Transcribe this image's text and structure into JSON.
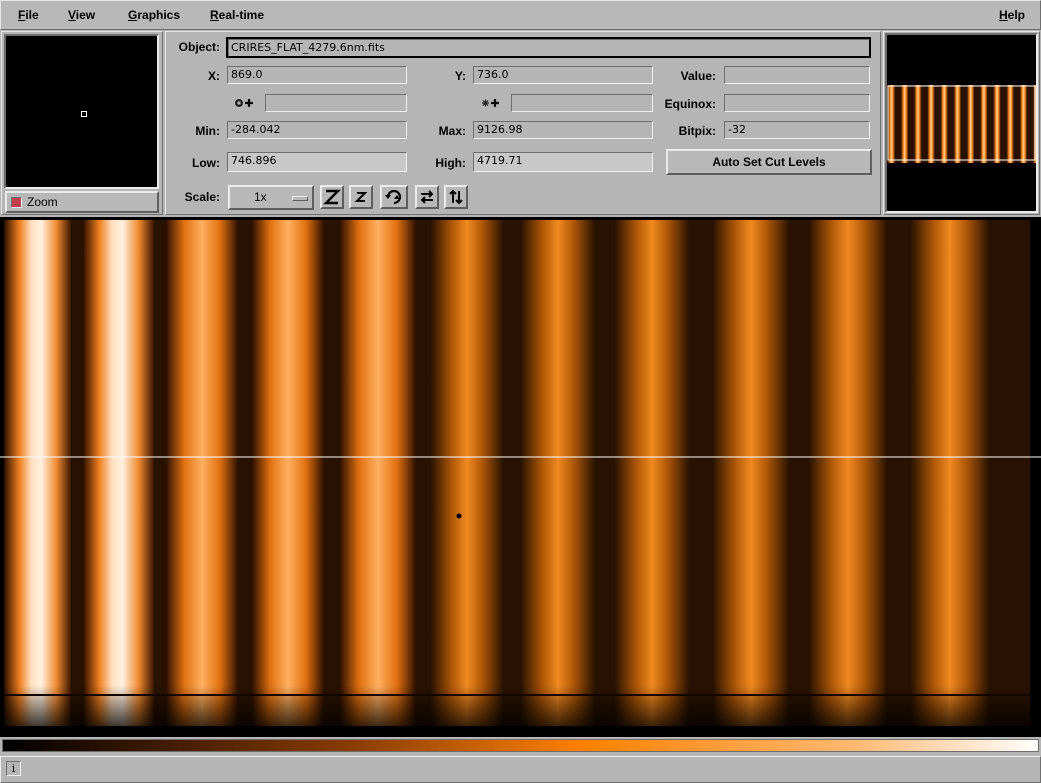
{
  "menubar": {
    "file": {
      "u": "F",
      "rest": "ile"
    },
    "view": {
      "u": "V",
      "rest": "iew"
    },
    "graphics": {
      "u": "G",
      "rest": "raphics"
    },
    "realtime": {
      "u": "R",
      "rest": "eal-time"
    },
    "help": {
      "u": "H",
      "rest": "elp"
    }
  },
  "zoom": {
    "label": "Zoom",
    "checked": true
  },
  "info": {
    "object_label": "Object:",
    "object_value": "CRIRES_FLAT_4279.6nm.fits",
    "x_label": "X:",
    "x_value": "869.0",
    "y_label": "Y:",
    "y_value": "736.0",
    "value_label": "Value:",
    "value_value": "",
    "ra_icon": "ra-crosshair-icon",
    "ra_value": "",
    "dec_icon": "dec-crosshair-icon",
    "dec_value": "",
    "equinox_label": "Equinox:",
    "equinox_value": "",
    "min_label": "Min:",
    "min_value": "-284.042",
    "max_label": "Max:",
    "max_value": "9126.98",
    "bitpix_label": "Bitpix:",
    "bitpix_value": "-32",
    "low_label": "Low:",
    "low_value": "746.896",
    "high_label": "High:",
    "high_value": "4719.71",
    "auto_cut_label": "Auto Set Cut Levels",
    "scale_label": "Scale:",
    "scale_value": "1x"
  },
  "toolbar_icons": [
    "zoom-in-icon",
    "zoom-out-icon",
    "rotate-icon",
    "flip-x-icon",
    "flip-y-icon"
  ],
  "colors": {
    "colormap": [
      "#000000",
      "#3a1800",
      "#8a3d00",
      "#ff8000",
      "#ffb870",
      "#ffffff"
    ],
    "background": "#b5b5b5"
  },
  "status": {
    "info_icon": "i"
  }
}
